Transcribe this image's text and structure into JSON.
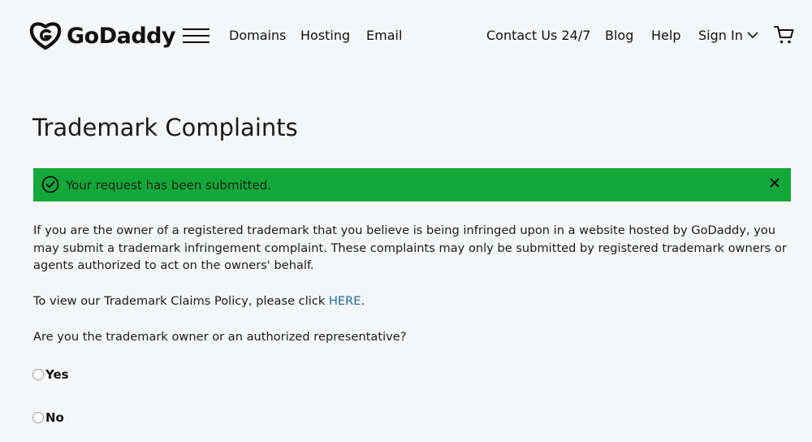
{
  "header": {
    "logo_text": "GoDaddy",
    "nav": [
      "Domains",
      "Hosting",
      "Email"
    ],
    "right_links": [
      "Contact Us 24/7",
      "Blog",
      "Help"
    ],
    "sign_in": "Sign In",
    "icons": [
      "godaddy-logo-icon",
      "hamburger-menu-icon",
      "chevron-down-icon",
      "cart-icon"
    ]
  },
  "page": {
    "title": "Trademark Complaints"
  },
  "alert": {
    "message": "Your request has been submitted.",
    "color": "#14a83b",
    "icons": [
      "check-circle-icon",
      "close-icon"
    ]
  },
  "content": {
    "intro": "If you are the owner of a registered trademark that you believe is being infringed upon in a website hosted by GoDaddy, you may submit a trademark infringement complaint. These complaints may only be submitted by registered trademark owners or agents authorized to act on the owners' behalf.",
    "policy_prefix": "To view our Trademark Claims Policy, please click ",
    "policy_link": "HERE",
    "policy_suffix": ".",
    "question": "Are you the trademark owner or an authorized representative?",
    "options": [
      "Yes",
      "No"
    ]
  },
  "colors": {
    "background": "#f4f6f7",
    "link": "#1c6aa8",
    "alert": "#14a83b"
  }
}
